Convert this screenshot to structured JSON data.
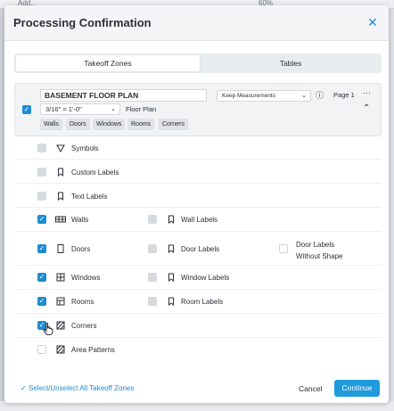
{
  "background": {
    "toolbar_text": "Add...",
    "zoom": "60%"
  },
  "dialog": {
    "title": "Processing Confirmation"
  },
  "tabs": [
    {
      "label": "Takeoff Zones"
    },
    {
      "label": "Tables"
    }
  ],
  "zone": {
    "name": "BASEMENT FLOOR PLAN",
    "scale": "3/16\" = 1'-0\"",
    "type": "Floor Plan",
    "measurement_option": "Keep Measurements",
    "page": "Page 1",
    "tags": [
      "Walls",
      "Doors",
      "Windows",
      "Rooms",
      "Corners"
    ]
  },
  "rows": [
    {
      "label": "Symbols",
      "icon": "triangle-icon"
    },
    {
      "label": "Custom Labels",
      "icon": "bookmark-icon"
    },
    {
      "label": "Text Labels",
      "icon": "bookmark-icon"
    },
    {
      "label": "Walls",
      "icon": "wall-icon",
      "sub_label": "Wall Labels"
    },
    {
      "label": "Doors",
      "icon": "door-icon",
      "sub_label": "Door Labels",
      "extra_label_line1": "Door Labels",
      "extra_label_line2": "Without Shape"
    },
    {
      "label": "Windows",
      "icon": "window-icon",
      "sub_label": "Window Labels"
    },
    {
      "label": "Rooms",
      "icon": "room-icon",
      "sub_label": "Room Labels"
    },
    {
      "label": "Corners",
      "icon": "hatch-icon"
    },
    {
      "label": "Area Patterns",
      "icon": "hatch-icon"
    }
  ],
  "footer": {
    "select_all": "Select/Unselect All Takeoff Zones",
    "cancel": "Cancel",
    "continue": "Continue"
  },
  "colors": {
    "accent": "#1f8ccf",
    "primary_button": "#1f9bdc"
  }
}
